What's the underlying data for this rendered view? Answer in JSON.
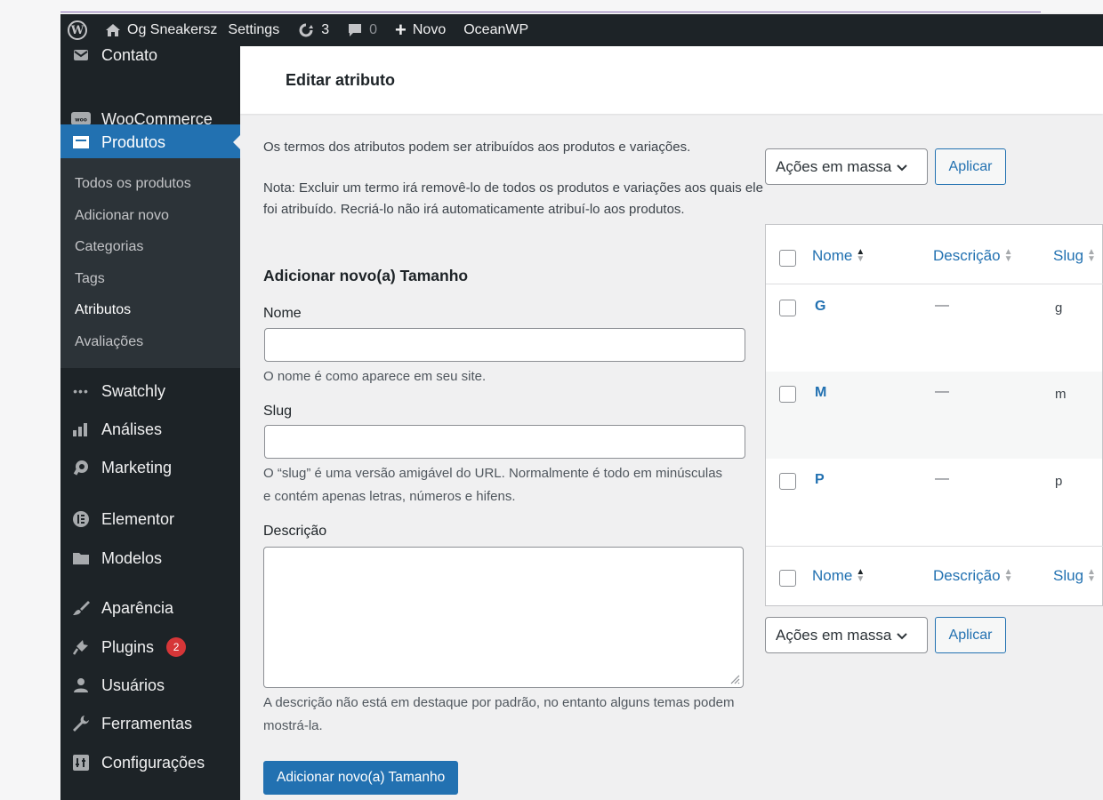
{
  "admin_bar": {
    "site_name": "Og Sneakersz",
    "settings_label": "Settings",
    "updates_count": "3",
    "comments_count": "0",
    "new_label": "Novo",
    "theme_label": "OceanWP"
  },
  "sidebar": {
    "contato": "Contato",
    "woocommerce": "WooCommerce",
    "produtos": "Produtos",
    "submenu": [
      "Todos os produtos",
      "Adicionar novo",
      "Categorias",
      "Tags",
      "Atributos",
      "Avaliações"
    ],
    "swatchly": "Swatchly",
    "analises": "Análises",
    "marketing": "Marketing",
    "elementor": "Elementor",
    "modelos": "Modelos",
    "aparencia": "Aparência",
    "plugins": "Plugins",
    "plugins_badge": "2",
    "usuarios": "Usuários",
    "ferramentas": "Ferramentas",
    "configuracoes": "Configurações"
  },
  "page": {
    "title": "Editar atributo"
  },
  "form": {
    "intro": "Os termos dos atributos podem ser atribuídos aos produtos e variações.",
    "note": "Nota: Excluir um termo irá removê-lo de todos os produtos e variações aos quais ele foi atribuído. Recriá-lo não irá automaticamente atribuí-lo aos produtos.",
    "heading": "Adicionar novo(a) Tamanho",
    "name_label": "Nome",
    "name_value": "",
    "name_help": "O nome é como aparece em seu site.",
    "slug_label": "Slug",
    "slug_value": "",
    "slug_help": "O “slug” é uma versão amigável do URL. Normalmente é todo em minúsculas e contém apenas letras, números e hifens.",
    "description_label": "Descrição",
    "description_value": "",
    "description_help": "A descrição não está em destaque por padrão, no entanto alguns temas podem mostrá-la.",
    "submit_label": "Adicionar novo(a) Tamanho"
  },
  "terms": {
    "bulk_actions_label": "Ações em massa",
    "apply_label": "Aplicar",
    "columns": [
      "Nome",
      "Descrição",
      "Slug"
    ],
    "rows": [
      {
        "name": "G",
        "description": "—",
        "slug": "g"
      },
      {
        "name": "M",
        "description": "—",
        "slug": "m"
      },
      {
        "name": "P",
        "description": "—",
        "slug": "p"
      }
    ]
  },
  "colors": {
    "admin_dark": "#1d2327",
    "accent_blue": "#2271b1",
    "badge_red": "#d63638"
  }
}
